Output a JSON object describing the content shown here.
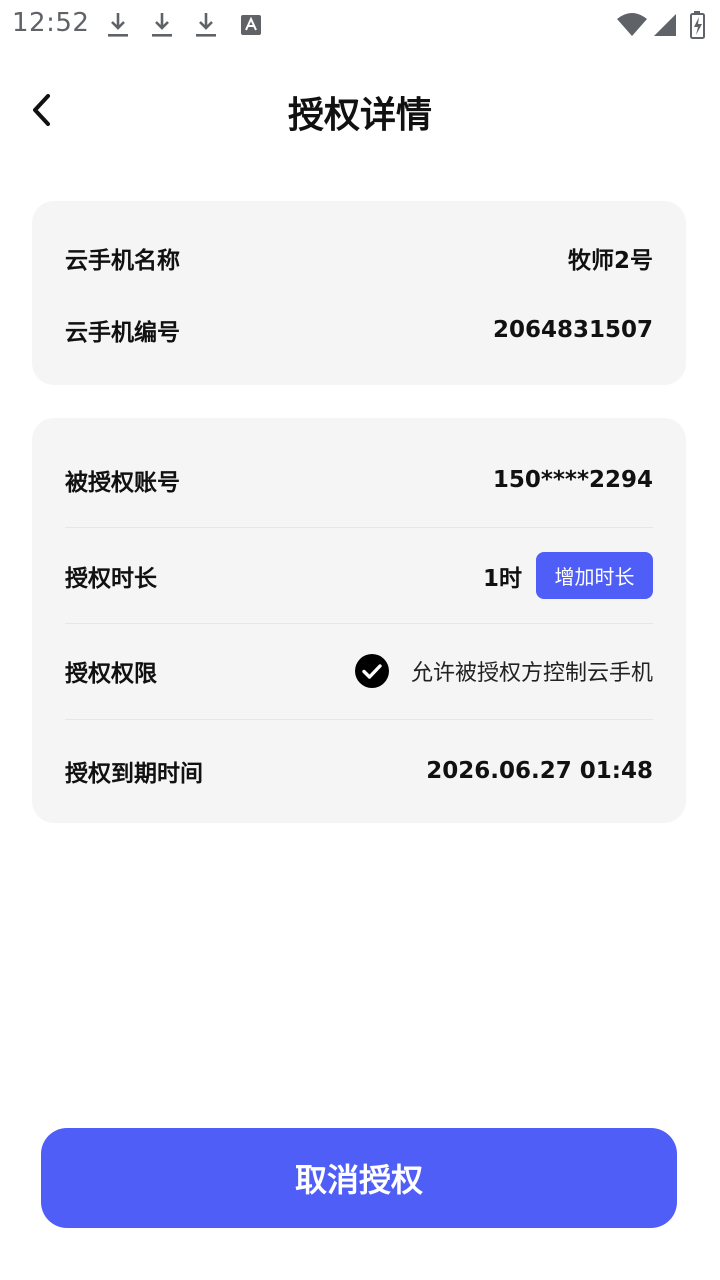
{
  "status_bar": {
    "time": "12:52",
    "icons": [
      "download-icon",
      "download-icon",
      "download-icon",
      "keyboard-a-icon",
      "wifi-icon",
      "signal-icon",
      "battery-charging-icon"
    ]
  },
  "header": {
    "title": "授权详情",
    "back_icon": "chevron-left-icon"
  },
  "phone_card": {
    "name_label": "云手机名称",
    "name_value": "牧师2号",
    "id_label": "云手机编号",
    "id_value": "2064831507"
  },
  "auth_card": {
    "account_label": "被授权账号",
    "account_value": "150****2294",
    "duration_label": "授权时长",
    "duration_value": "1时",
    "add_duration_button": "增加时长",
    "permission_label": "授权权限",
    "permission_text": "允许被授权方控制云手机",
    "permission_checked": true,
    "expire_label": "授权到期时间",
    "expire_value": "2026.06.27 01:48"
  },
  "actions": {
    "cancel_label": "取消授权"
  },
  "colors": {
    "accent": "#4f5ef7",
    "card_bg": "#f5f5f5",
    "text": "#111111"
  }
}
